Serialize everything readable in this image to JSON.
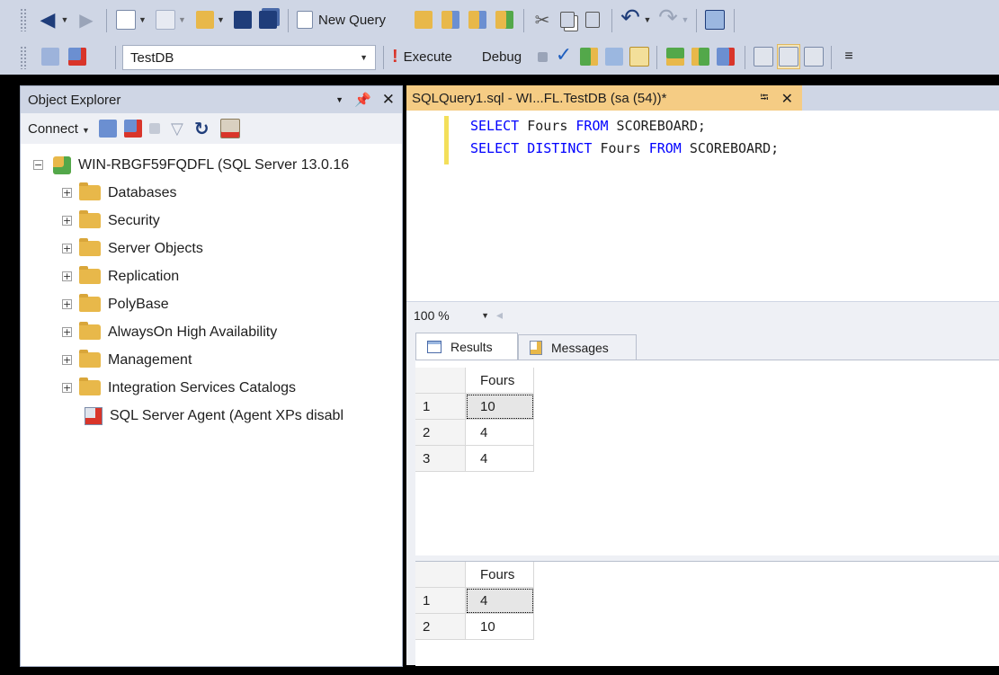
{
  "toolbar_top": {
    "new_query_label": "New Query"
  },
  "toolbar_sql": {
    "database": "TestDB",
    "execute_label": "Execute",
    "debug_label": "Debug"
  },
  "object_explorer": {
    "title": "Object Explorer",
    "pin_glyph": "⬇",
    "connect_label": "Connect",
    "server": "WIN-RBGF59FQDFL (SQL Server 13.0.16",
    "nodes": [
      {
        "label": "Databases"
      },
      {
        "label": "Security"
      },
      {
        "label": "Server Objects"
      },
      {
        "label": "Replication"
      },
      {
        "label": "PolyBase"
      },
      {
        "label": "AlwaysOn High Availability"
      },
      {
        "label": "Management"
      },
      {
        "label": "Integration Services Catalogs"
      },
      {
        "label": "SQL Server Agent (Agent XPs disabl"
      }
    ]
  },
  "editor": {
    "tab_title": "SQLQuery1.sql - WI...FL.TestDB (sa (54))*",
    "lines": [
      {
        "k1": "SELECT",
        "t1": " Fours ",
        "k2": "FROM",
        "t2": " SCOREBOARD;"
      },
      {
        "k1": "SELECT DISTINCT",
        "t1": " Fours ",
        "k2": "FROM",
        "t2": " SCOREBOARD;"
      }
    ]
  },
  "zoom": {
    "value": "100 %"
  },
  "results": {
    "tabs": {
      "results": "Results",
      "messages": "Messages"
    },
    "grids": [
      {
        "column": "Fours",
        "rows": [
          {
            "num": "1",
            "value": "10"
          },
          {
            "num": "2",
            "value": "4"
          },
          {
            "num": "3",
            "value": "4"
          }
        ]
      },
      {
        "column": "Fours",
        "rows": [
          {
            "num": "1",
            "value": "4"
          },
          {
            "num": "2",
            "value": "10"
          }
        ]
      }
    ]
  },
  "colors": {
    "chrome": "#cfd6e5",
    "active_tab": "#f5cc84",
    "keyword": "#0000ff",
    "folder": "#e8b84a"
  }
}
